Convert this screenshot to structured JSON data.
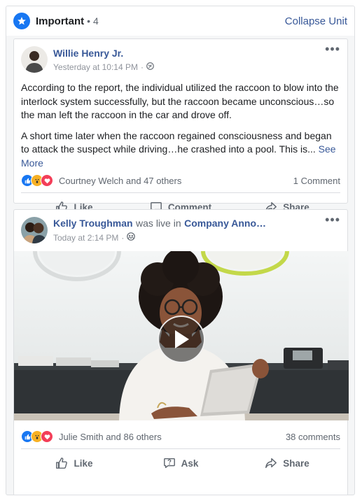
{
  "unit": {
    "title": "Important",
    "count": "• 4",
    "collapse_label": "Collapse Unit"
  },
  "post1": {
    "author": "Willie Henry Jr.",
    "timestamp": "Yesterday at 10:14 PM",
    "privacy_icon": "globe-icon",
    "paragraph1": "According to the report, the individual utilized the raccoon to blow into the interlock system successfully, but the raccoon became unconscious…so the man left the raccoon in the car and drove off.",
    "paragraph2": "A short time later when the raccoon regained consciousness and began to attack the suspect while driving…he crashed into a pool. This is...",
    "see_more": "See More",
    "reactions_text": "Courtney Welch and 47 others",
    "comments_text": "1 Comment",
    "actions": [
      "Like",
      "Comment",
      "Share"
    ]
  },
  "post2": {
    "author": "Kelly Troughman",
    "middle_text": "was live in",
    "group": "Company Anno…",
    "timestamp": "Today at 2:14 PM",
    "privacy_icon": "group-icon",
    "reactions_text": "Julie Smith and 86 others",
    "comments_text": "38 comments",
    "actions": [
      "Like",
      "Ask",
      "Share"
    ]
  },
  "colors": {
    "accent": "#1877f2",
    "link": "#385898",
    "muted": "#606770"
  }
}
